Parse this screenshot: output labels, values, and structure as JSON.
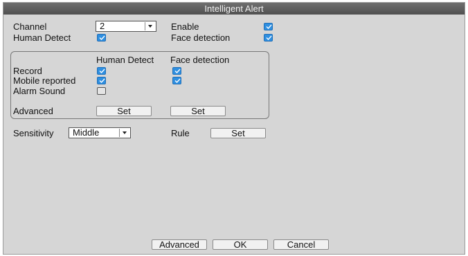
{
  "window": {
    "title": "Intelligent Alert"
  },
  "top": {
    "channel_label": "Channel",
    "channel_value": "2",
    "enable_label": "Enable",
    "enable_checked": true,
    "human_detect_label": "Human Detect",
    "human_detect_checked": true,
    "face_detection_label": "Face detection",
    "face_detection_checked": true
  },
  "group": {
    "col_human": "Human Detect",
    "col_face": "Face detection",
    "rows": [
      {
        "label": "Record",
        "human": true,
        "face": true
      },
      {
        "label": "Mobile reported",
        "human": true,
        "face": true
      },
      {
        "label": "Alarm Sound",
        "human": false,
        "face": null
      }
    ],
    "advanced_label": "Advanced",
    "set_human": "Set",
    "set_face": "Set"
  },
  "sensitivity": {
    "label": "Sensitivity",
    "value": "Middle"
  },
  "rule": {
    "label": "Rule",
    "button": "Set"
  },
  "footer": {
    "advanced": "Advanced",
    "ok": "OK",
    "cancel": "Cancel"
  },
  "colors": {
    "checkbox": "#2f8fe0",
    "titlebar": "#5a5a5a",
    "panel": "#d6d6d6"
  }
}
